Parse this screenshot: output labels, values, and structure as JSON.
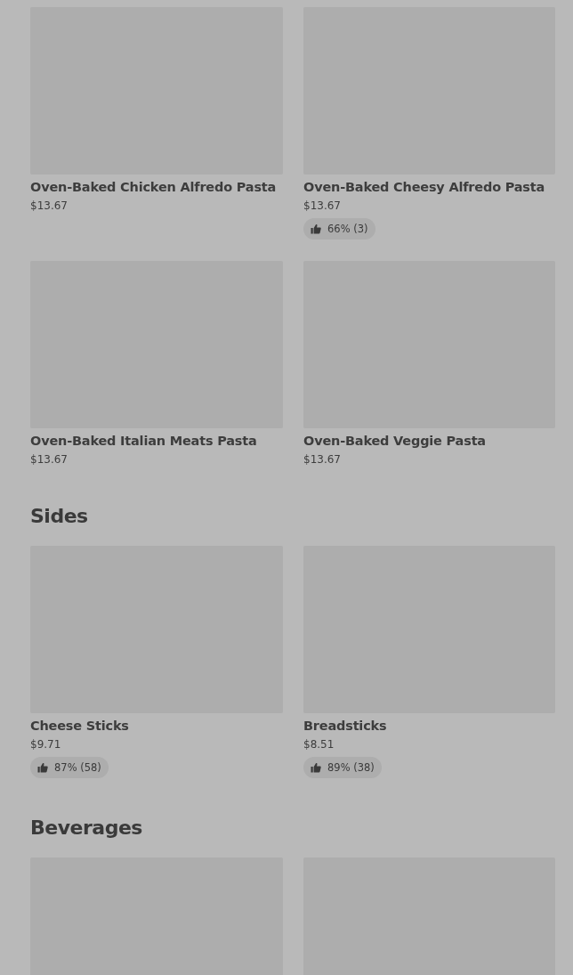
{
  "sections": [
    {
      "items": [
        {
          "kind": "product",
          "name": "Oven-Baked Chicken Alfredo Pasta",
          "price": "$13.67"
        },
        {
          "kind": "product",
          "name": "Oven-Baked Cheesy Alfredo Pasta",
          "price": "$13.67",
          "rating": "66% (3)"
        },
        {
          "kind": "product",
          "name": "Oven-Baked Italian Meats Pasta",
          "price": "$13.67"
        },
        {
          "kind": "product",
          "name": "Oven-Baked Veggie Pasta",
          "price": "$13.67"
        }
      ]
    },
    {
      "title": "Sides",
      "items": [
        {
          "kind": "product",
          "name": "Cheese Sticks",
          "price": "$9.71",
          "rating": "87% (58)"
        },
        {
          "kind": "product",
          "name": "Breadsticks",
          "price": "$8.51",
          "rating": "89% (38)"
        }
      ]
    },
    {
      "title": "Beverages",
      "items": [
        {
          "kind": "image-only"
        },
        {
          "kind": "image-only"
        }
      ]
    }
  ]
}
